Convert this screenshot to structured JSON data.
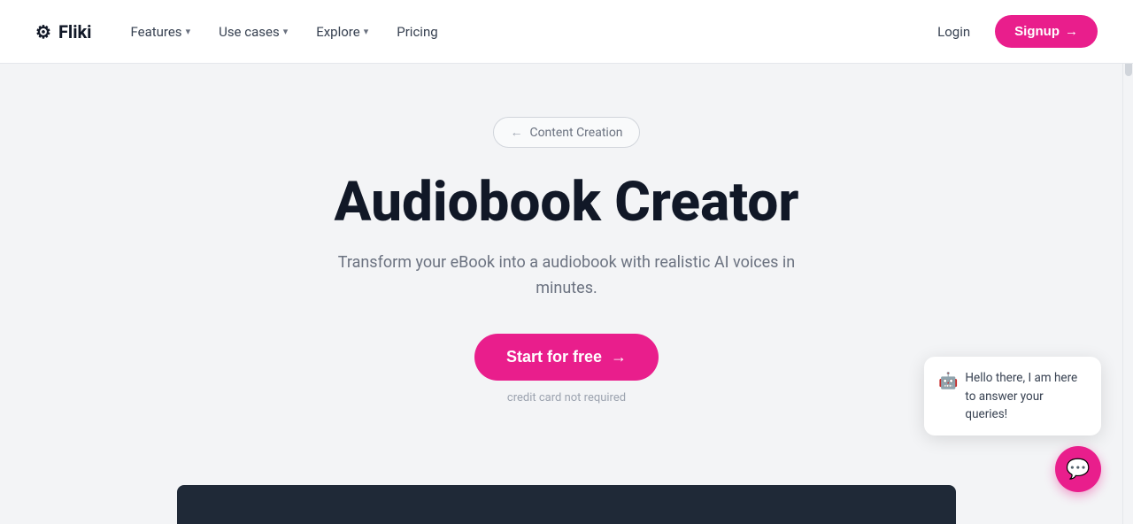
{
  "brand": {
    "logo_text": "Fliki",
    "logo_icon": "⚙"
  },
  "navbar": {
    "features_label": "Features",
    "use_cases_label": "Use cases",
    "explore_label": "Explore",
    "pricing_label": "Pricing",
    "login_label": "Login",
    "signup_label": "Signup",
    "signup_arrow": "→"
  },
  "breadcrumb": {
    "back_arrow": "←",
    "label": "Content Creation"
  },
  "hero": {
    "heading": "Audiobook Creator",
    "subtitle": "Transform your eBook into a audiobook with realistic AI voices in minutes.",
    "cta_label": "Start for free",
    "cta_arrow": "→",
    "credit_note": "credit card not required"
  },
  "chat": {
    "emoji": "🤖",
    "message": "Hello there, I am here to answer your queries!",
    "button_icon": "💬"
  },
  "colors": {
    "brand_pink": "#e91e8c",
    "dark_preview": "#1f2937"
  }
}
